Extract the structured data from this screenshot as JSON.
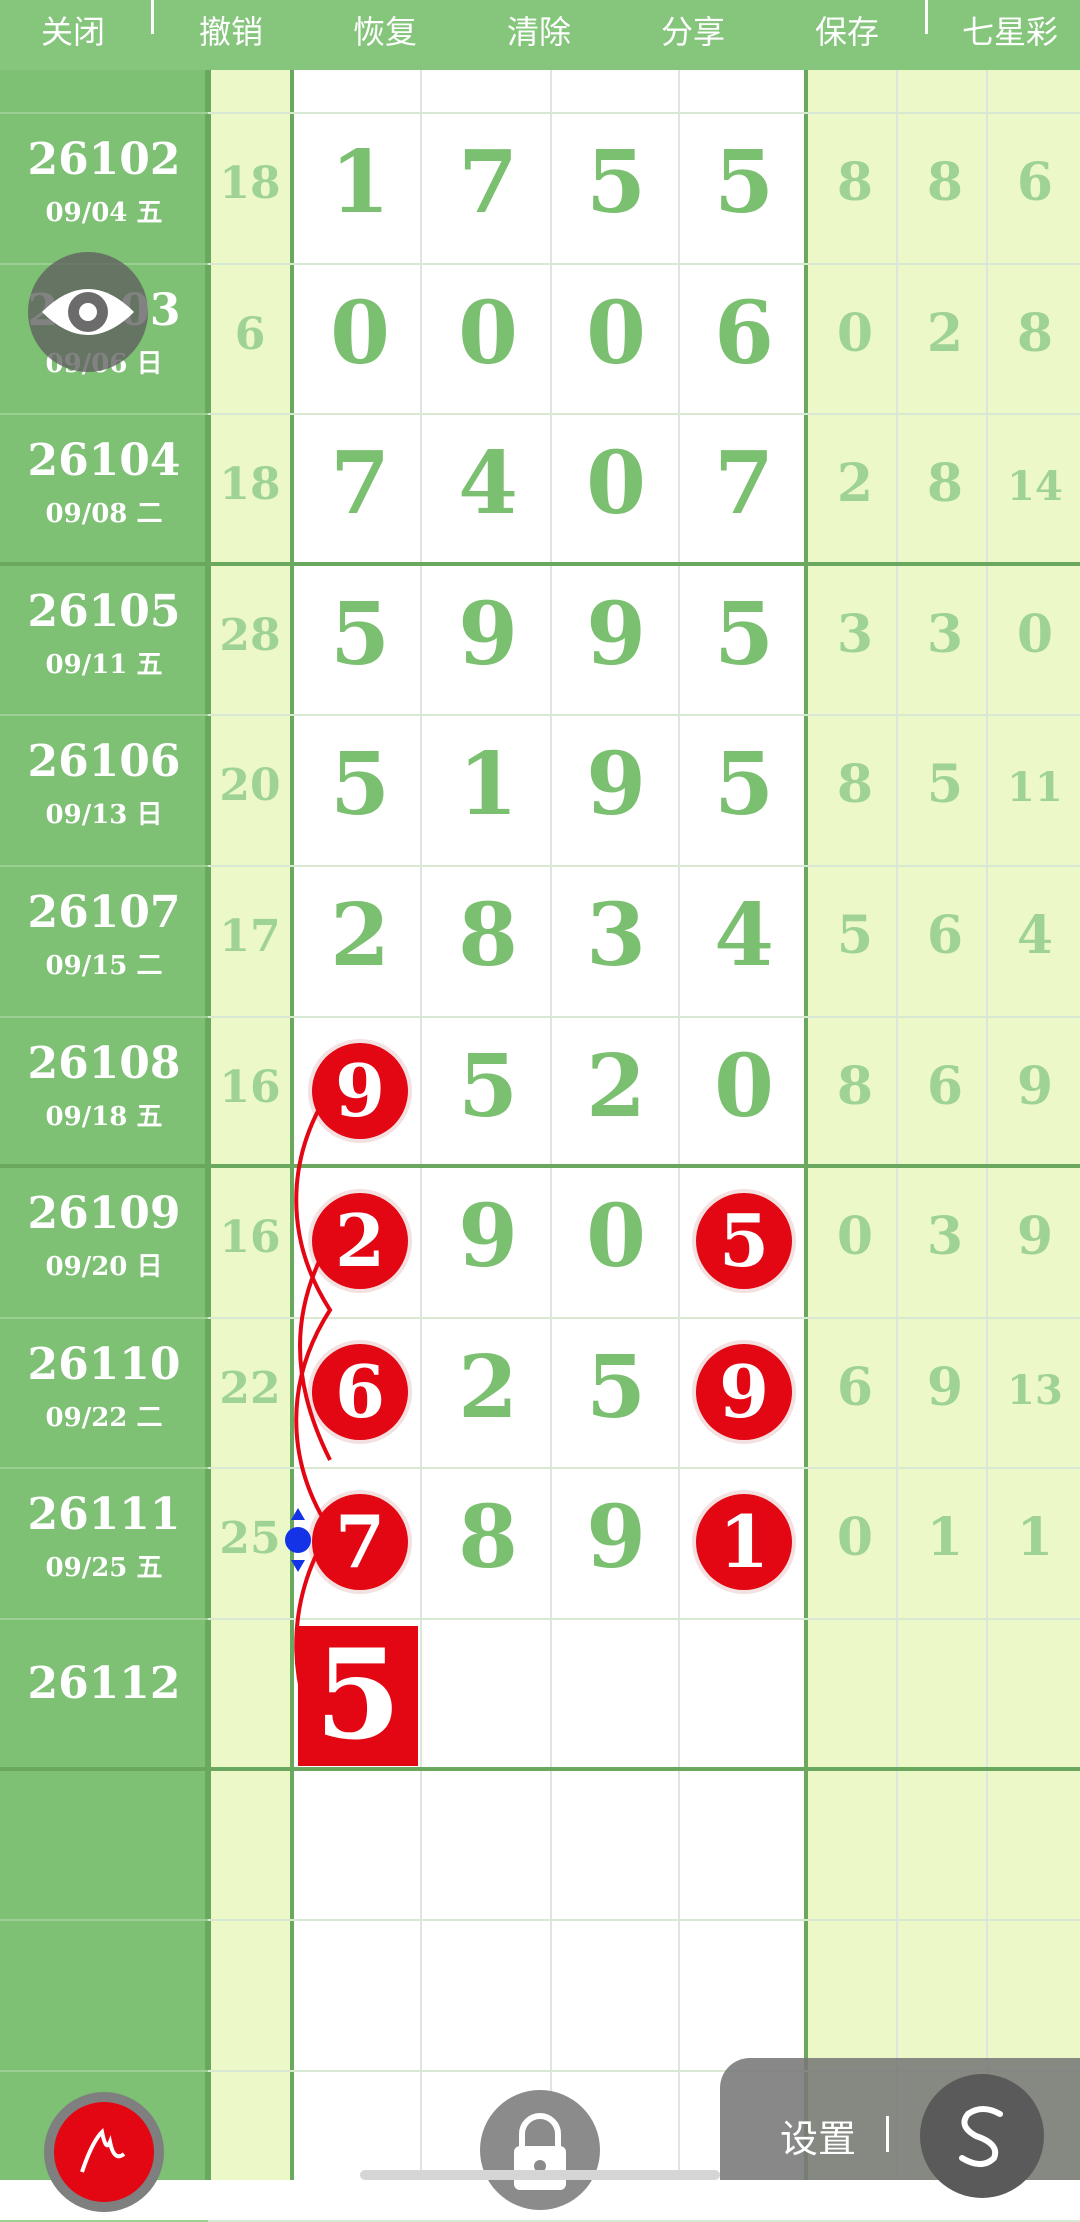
{
  "toolbar": {
    "close": "关闭",
    "undo": "撤销",
    "redo": "恢复",
    "clear": "清除",
    "share": "分享",
    "save": "保存",
    "lottery": "七星彩"
  },
  "rows": [
    {
      "issue": "26102",
      "date": "09/04 五",
      "sum": "18",
      "digits": [
        "1",
        "7",
        "5",
        "5"
      ],
      "right": [
        "8",
        "8",
        "6"
      ]
    },
    {
      "issue": "26103",
      "date": "09/06 日",
      "sum": "6",
      "digits": [
        "0",
        "0",
        "0",
        "6"
      ],
      "right": [
        "0",
        "2",
        "8"
      ]
    },
    {
      "issue": "26104",
      "date": "09/08 二",
      "sum": "18",
      "digits": [
        "7",
        "4",
        "0",
        "7"
      ],
      "right": [
        "2",
        "8",
        "14"
      ]
    },
    {
      "issue": "26105",
      "date": "09/11 五",
      "sum": "28",
      "digits": [
        "5",
        "9",
        "9",
        "5"
      ],
      "right": [
        "3",
        "3",
        "0"
      ]
    },
    {
      "issue": "26106",
      "date": "09/13 日",
      "sum": "20",
      "digits": [
        "5",
        "1",
        "9",
        "5"
      ],
      "right": [
        "8",
        "5",
        "11"
      ]
    },
    {
      "issue": "26107",
      "date": "09/15 二",
      "sum": "17",
      "digits": [
        "2",
        "8",
        "3",
        "4"
      ],
      "right": [
        "5",
        "6",
        "4"
      ]
    },
    {
      "issue": "26108",
      "date": "09/18 五",
      "sum": "16",
      "digits": [
        "9",
        "5",
        "2",
        "0"
      ],
      "right": [
        "8",
        "6",
        "9"
      ]
    },
    {
      "issue": "26109",
      "date": "09/20 日",
      "sum": "16",
      "digits": [
        "2",
        "9",
        "0",
        "5"
      ],
      "right": [
        "0",
        "3",
        "9"
      ]
    },
    {
      "issue": "26110",
      "date": "09/22 二",
      "sum": "22",
      "digits": [
        "6",
        "2",
        "5",
        "9"
      ],
      "right": [
        "6",
        "9",
        "13"
      ]
    },
    {
      "issue": "26111",
      "date": "09/25 五",
      "sum": "25",
      "digits": [
        "7",
        "8",
        "9",
        "1"
      ],
      "right": [
        "0",
        "1",
        "1"
      ]
    }
  ],
  "next_issue": {
    "issue": "26112",
    "pick": "5"
  },
  "marked": [
    {
      "row": 6,
      "col": 0
    },
    {
      "row": 7,
      "col": 0
    },
    {
      "row": 8,
      "col": 0
    },
    {
      "row": 9,
      "col": 0
    },
    {
      "row": 7,
      "col": 3
    },
    {
      "row": 8,
      "col": 3
    },
    {
      "row": 9,
      "col": 3
    }
  ],
  "settings": {
    "label": "设置"
  },
  "colors": {
    "header_green": "#85c57c",
    "issue_green": "#7ec074",
    "digit_green": "#7bc070",
    "pale_green": "#edf8c9",
    "mark_red": "#e30613"
  }
}
